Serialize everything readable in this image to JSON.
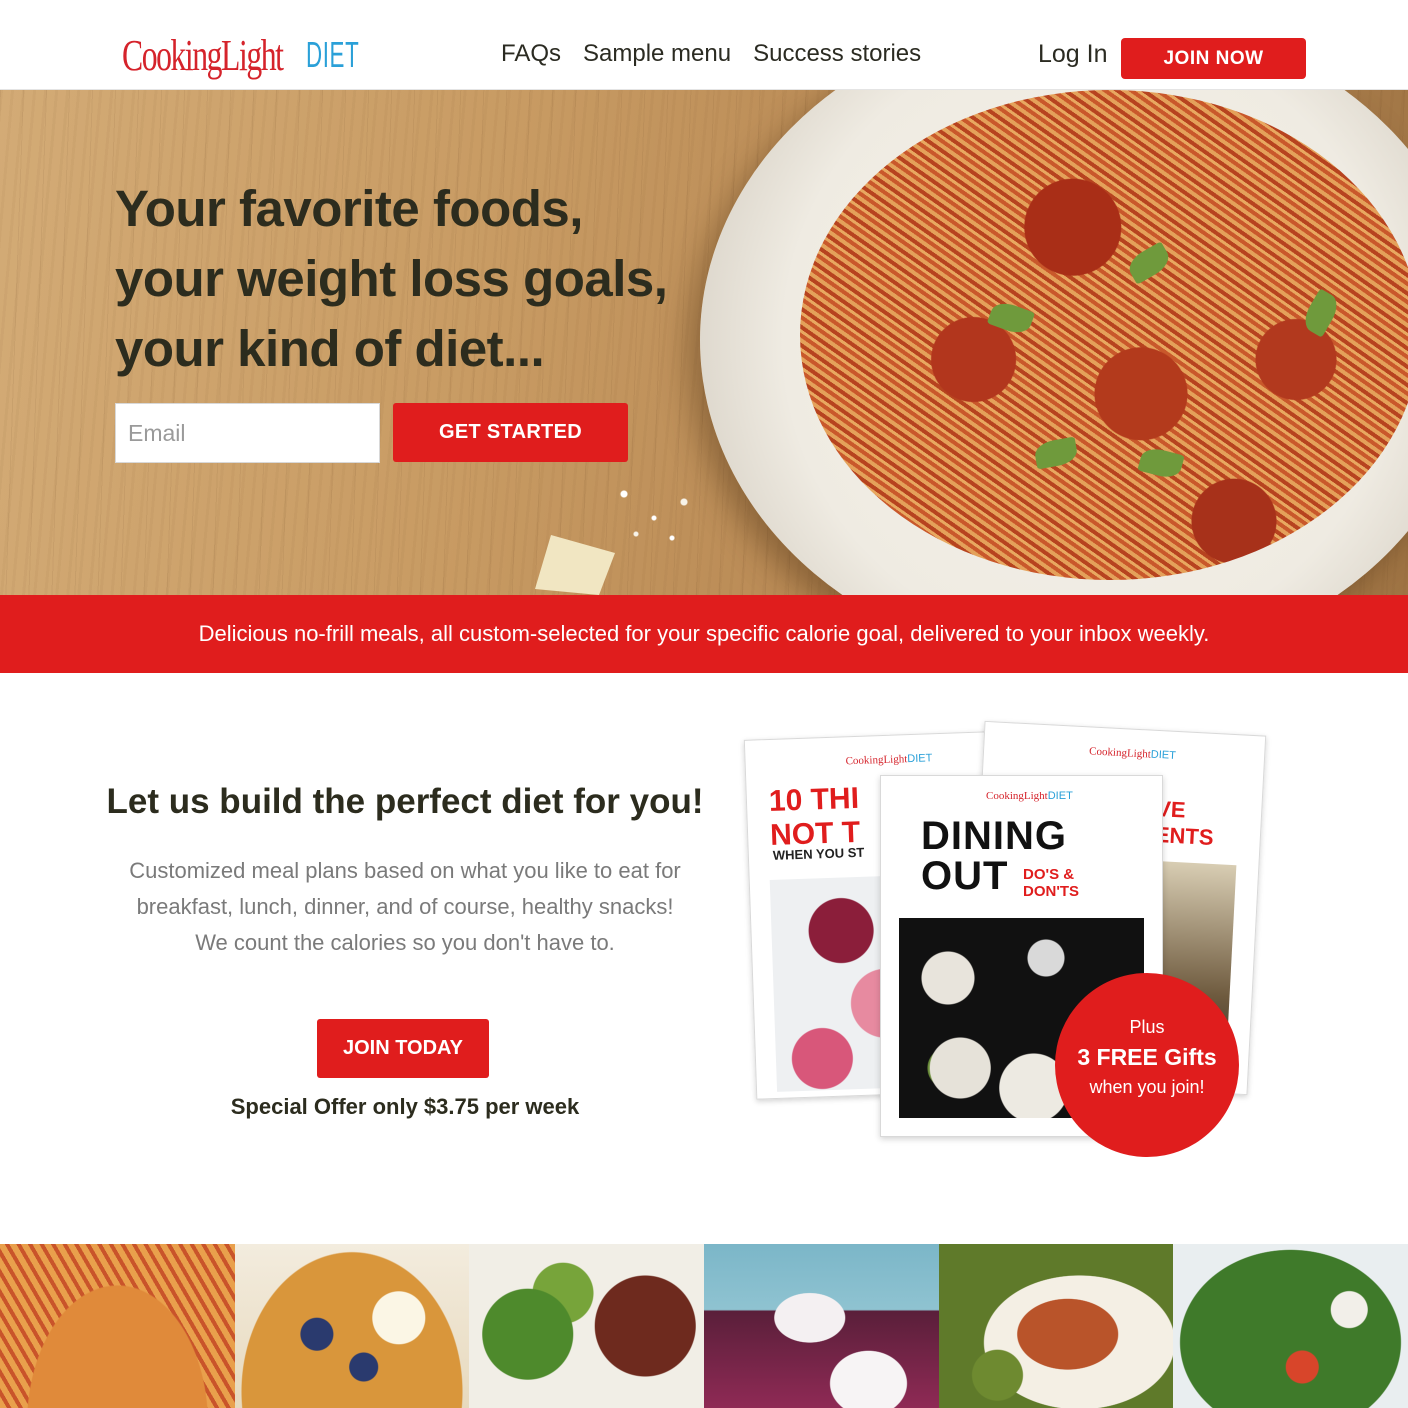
{
  "header": {
    "logo_main": "CookingLight",
    "logo_diet": "DIET",
    "nav": [
      "FAQs",
      "Sample menu",
      "Success stories"
    ],
    "login": "Log In",
    "join_now": "JOIN NOW"
  },
  "hero": {
    "title_lines": [
      "Your favorite foods,",
      "your weight loss goals,",
      "your kind of diet..."
    ],
    "email_placeholder": "Email",
    "cta": "GET STARTED"
  },
  "banner": {
    "text": "Delicious no-frill meals, all custom-selected for your specific calorie goal, delivered to your inbox weekly."
  },
  "build": {
    "title": "Let us build the perfect diet for you!",
    "desc_lines": [
      "Customized meal plans based on what you like to eat for",
      "breakfast, lunch, dinner, and of course, healthy snacks!",
      "We count the calories so you don't have to."
    ],
    "cta": "JOIN TODAY",
    "offer": "Special Offer only $3.75 per week"
  },
  "booklets": {
    "mini_logo_main": "CookingLight",
    "mini_logo_diet": "DIET",
    "left_title": "10 THI\nNOT T",
    "left_sub": "WHEN YOU ST",
    "right_title": "VE\nENTS",
    "center_title": "DINING\nOUT",
    "center_sub": "DO'S &\nDON'TS"
  },
  "gift": {
    "line1": "Plus",
    "line2": "3 FREE Gifts",
    "line3": "when you join!"
  },
  "colors": {
    "brand_red": "#e01d1d",
    "logo_blue": "#2aa0d8",
    "heading": "#2c2c1e"
  }
}
